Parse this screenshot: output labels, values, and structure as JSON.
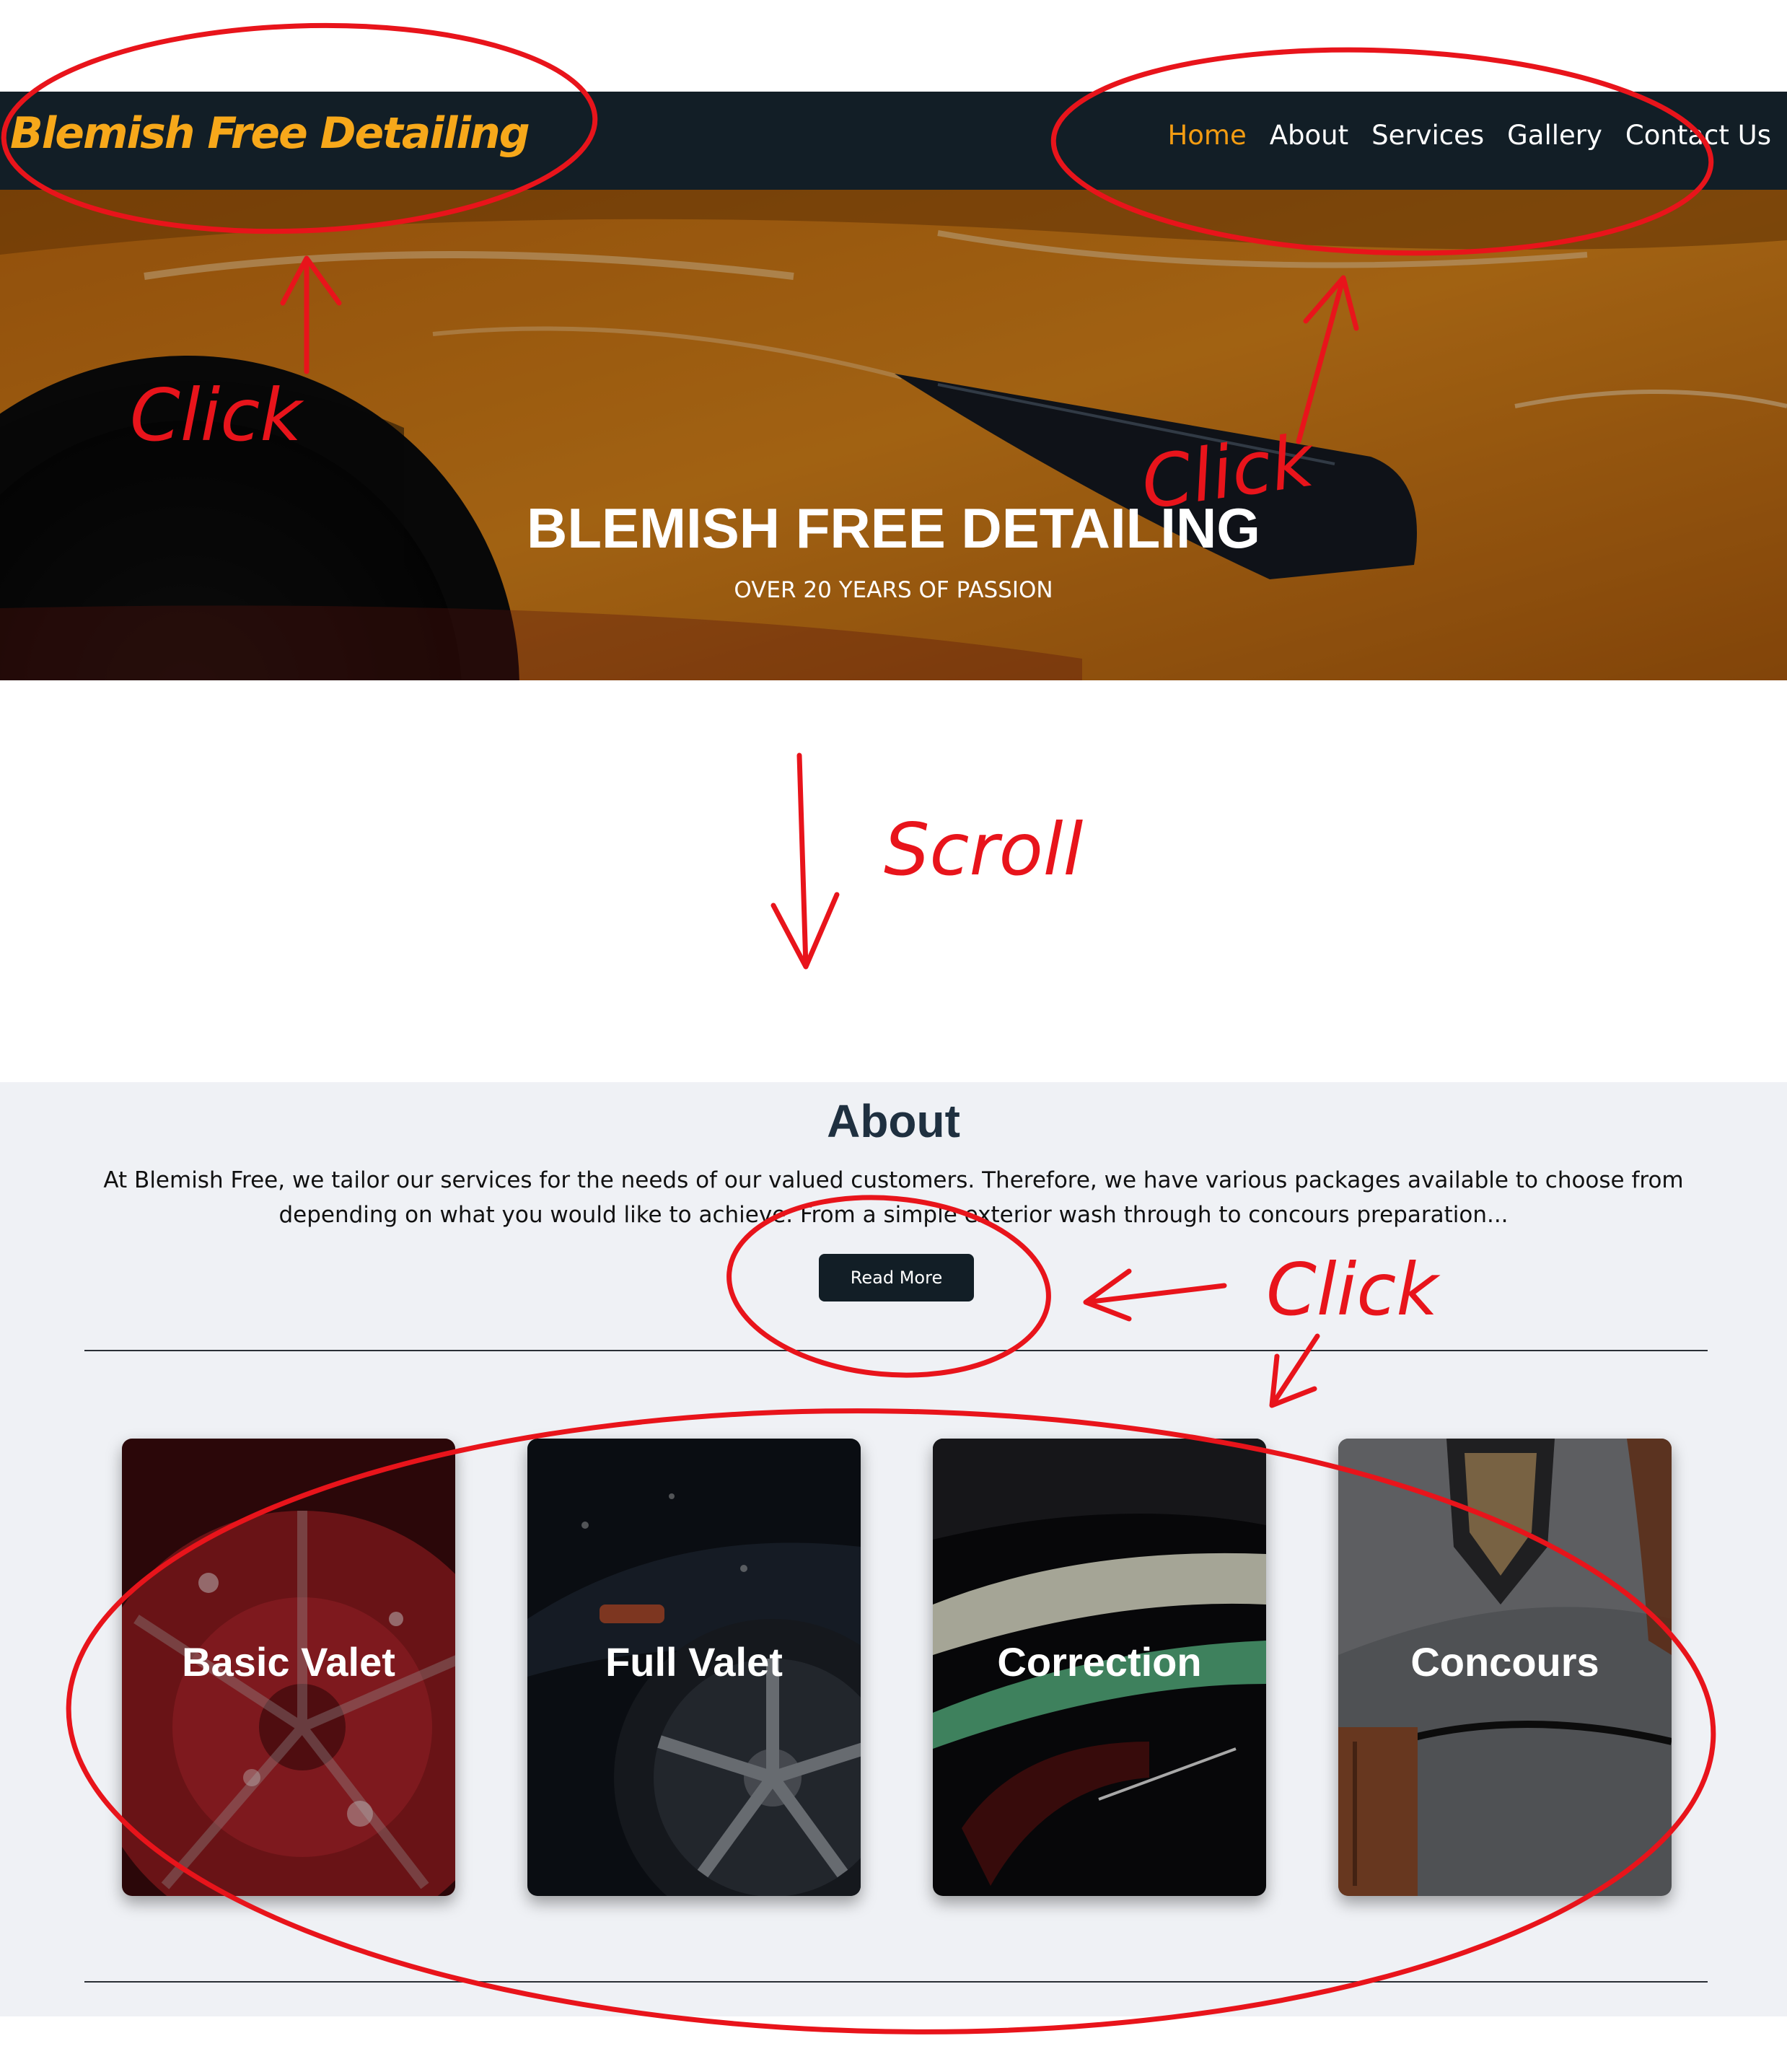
{
  "navbar": {
    "brand": "Blemish Free Detailing",
    "links": [
      {
        "label": "Home",
        "active": true
      },
      {
        "label": "About",
        "active": false
      },
      {
        "label": "Services",
        "active": false
      },
      {
        "label": "Gallery",
        "active": false
      },
      {
        "label": "Contact Us",
        "active": false
      }
    ]
  },
  "hero": {
    "title": "BLEMISH FREE DETAILING",
    "subtitle": "OVER 20 YEARS OF PASSION"
  },
  "about": {
    "heading": "About",
    "text": "At Blemish Free, we tailor our services for the needs of our valued customers. Therefore, we have various packages available to choose from depending on what you would like to achieve. From a simple exterior wash through to concours preparation...",
    "read_more": "Read More"
  },
  "services": [
    {
      "label": "Basic Valet"
    },
    {
      "label": "Full Valet"
    },
    {
      "label": "Correction"
    },
    {
      "label": "Concours"
    }
  ],
  "annotations": {
    "click_labels": [
      "Click",
      "Click",
      "Click"
    ],
    "scroll_label": "Scroll"
  },
  "colors": {
    "navbar_bg": "#121e26",
    "brand": "#f7a81a",
    "nav_active": "#f39c12",
    "section_bg": "#eff1f5",
    "annotation": "#e8141b"
  }
}
